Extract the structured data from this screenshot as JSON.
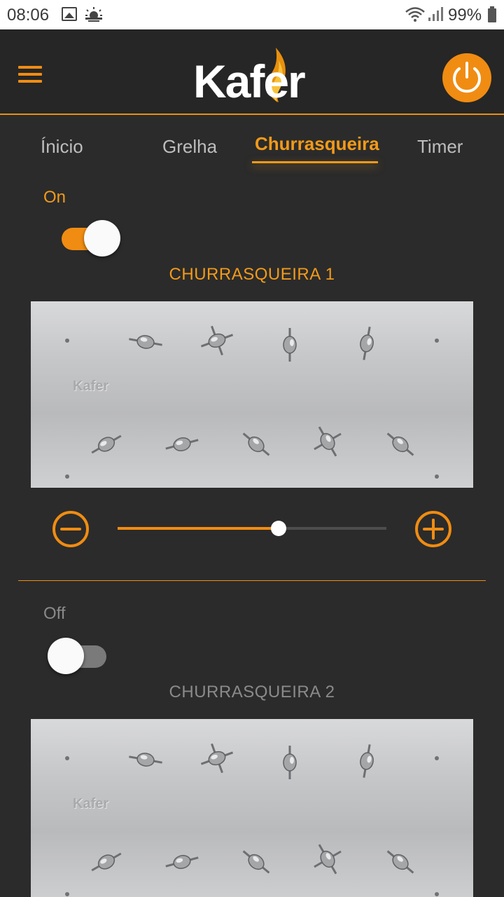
{
  "status_bar": {
    "time": "08:06",
    "battery": "99%",
    "icons": [
      "image-icon",
      "weather-icon",
      "wifi-icon",
      "signal-icon",
      "battery-icon"
    ]
  },
  "header": {
    "logo_text": "Kafer",
    "menu_icon": "hamburger-menu-icon",
    "power_icon": "power-icon",
    "accent_color": "#f08c12"
  },
  "tabs": [
    {
      "label": "Ínicio",
      "active": false
    },
    {
      "label": "Grelha",
      "active": false
    },
    {
      "label": "Churrasqueira",
      "active": true
    },
    {
      "label": "Timer",
      "active": false
    }
  ],
  "grills": [
    {
      "state_label": "On",
      "on": true,
      "title": "CHURRASQUEIRA 1",
      "panel_logo": "Kafer",
      "level": 0.6
    },
    {
      "state_label": "Off",
      "on": false,
      "title": "CHURRASQUEIRA 2",
      "panel_logo": "Kafer"
    }
  ],
  "colors": {
    "accent": "#f29a1a",
    "background": "#2b2b2b",
    "inactive_text": "#8a8a8a"
  }
}
